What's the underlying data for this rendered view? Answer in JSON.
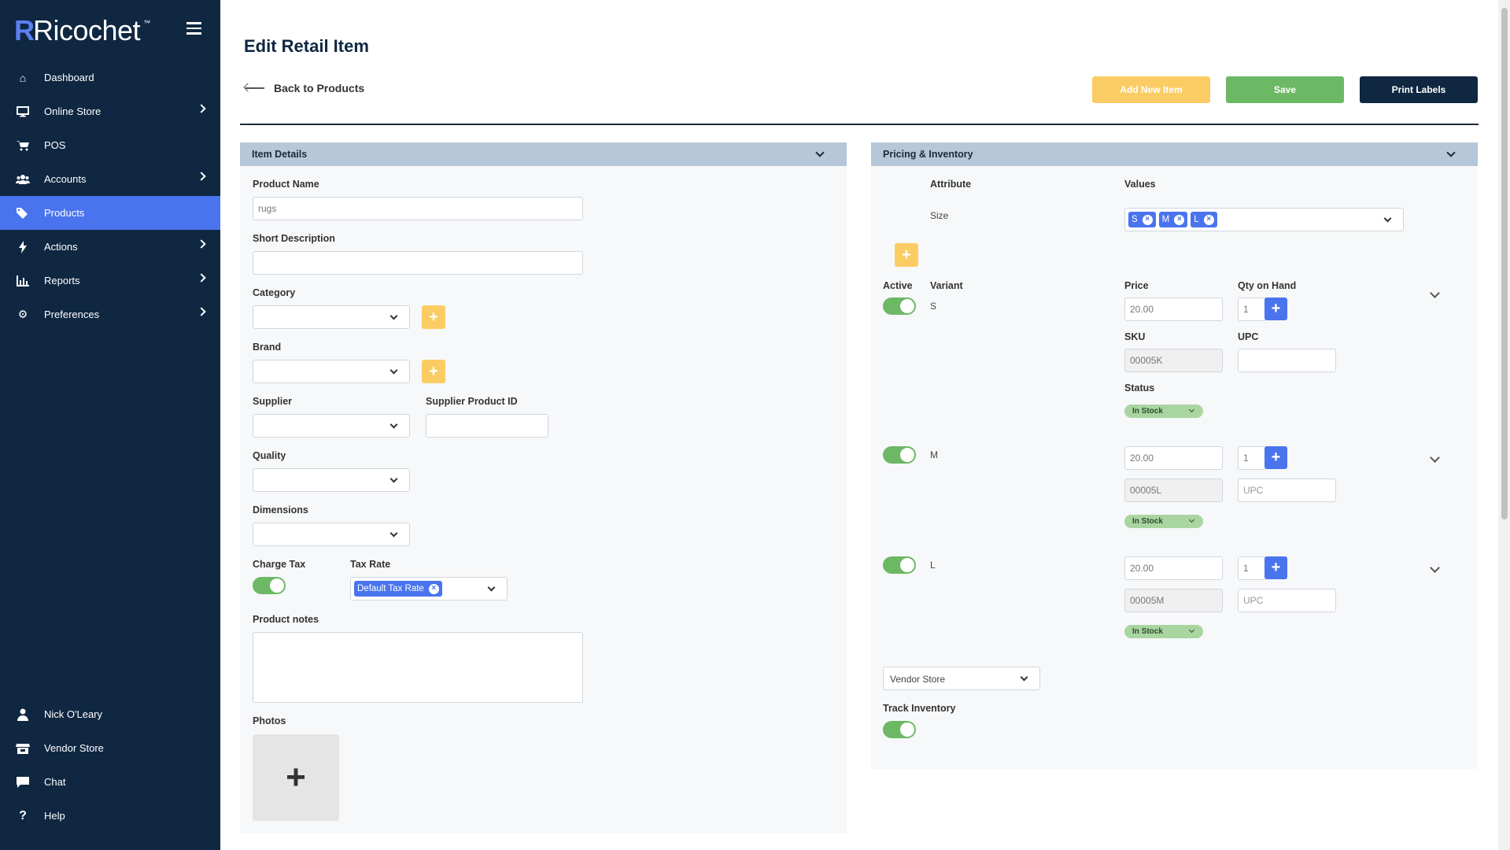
{
  "app": {
    "logo": "Ricochet",
    "logo_tm": "™"
  },
  "sidebar": {
    "items": [
      {
        "label": "Dashboard",
        "icon": "home-icon",
        "chevron": false,
        "active": false
      },
      {
        "label": "Online Store",
        "icon": "monitor-icon",
        "chevron": true,
        "active": false
      },
      {
        "label": "POS",
        "icon": "cart-icon",
        "chevron": false,
        "active": false
      },
      {
        "label": "Accounts",
        "icon": "users-icon",
        "chevron": true,
        "active": false
      },
      {
        "label": "Products",
        "icon": "tags-icon",
        "chevron": false,
        "active": true
      },
      {
        "label": "Actions",
        "icon": "bolt-icon",
        "chevron": true,
        "active": false
      },
      {
        "label": "Reports",
        "icon": "chart-icon",
        "chevron": true,
        "active": false
      },
      {
        "label": "Preferences",
        "icon": "gear-icon",
        "chevron": true,
        "active": false
      }
    ],
    "bottom_items": [
      {
        "label": "Nick O'Leary",
        "icon": "user-icon"
      },
      {
        "label": "Vendor Store",
        "icon": "store-icon"
      },
      {
        "label": "Chat",
        "icon": "chat-icon"
      },
      {
        "label": "Help",
        "icon": "help-icon"
      }
    ]
  },
  "header": {
    "title": "Edit Retail Item",
    "back_label": "Back to Products",
    "add_new_label": "Add New Item",
    "save_label": "Save",
    "print_label": "Print Labels"
  },
  "item_details": {
    "title": "Item Details",
    "product_name_label": "Product Name",
    "product_name_value": "rugs",
    "short_description_label": "Short Description",
    "short_description_value": "",
    "category_label": "Category",
    "brand_label": "Brand",
    "supplier_label": "Supplier",
    "supplier_product_id_label": "Supplier Product ID",
    "quality_label": "Quality",
    "dimensions_label": "Dimensions",
    "charge_tax_label": "Charge Tax",
    "charge_tax_on": true,
    "tax_rate_label": "Tax Rate",
    "tax_rate_chip": "Default Tax Rate",
    "product_notes_label": "Product notes",
    "photos_label": "Photos",
    "add_photo_glyph": "+"
  },
  "pricing": {
    "title": "Pricing & Inventory",
    "attribute_header": "Attribute",
    "values_header": "Values",
    "attribute_name": "Size",
    "attribute_values": [
      "S",
      "M",
      "L"
    ],
    "active_header": "Active",
    "variant_header": "Variant",
    "price_header": "Price",
    "qty_header": "Qty on Hand",
    "sku_label": "SKU",
    "upc_label": "UPC",
    "status_label": "Status",
    "upc_placeholder": "UPC",
    "variants": [
      {
        "name": "S",
        "price": "20.00",
        "qty": "1",
        "sku": "00005K",
        "upc": "",
        "status": "In Stock",
        "active": true
      },
      {
        "name": "M",
        "price": "20.00",
        "qty": "1",
        "sku": "00005L",
        "upc": "",
        "status": "In Stock",
        "active": true
      },
      {
        "name": "L",
        "price": "20.00",
        "qty": "1",
        "sku": "00005M",
        "upc": "",
        "status": "In Stock",
        "active": true
      }
    ],
    "store_select": "Vendor Store",
    "track_inventory_label": "Track Inventory",
    "track_inventory_on": true
  },
  "colors": {
    "sidebar_bg": "#0f2741",
    "accent_blue": "#4a74ee",
    "accent_yellow": "#fbcc64",
    "accent_green": "#6db865",
    "panel_header": "#b5c7d8"
  }
}
